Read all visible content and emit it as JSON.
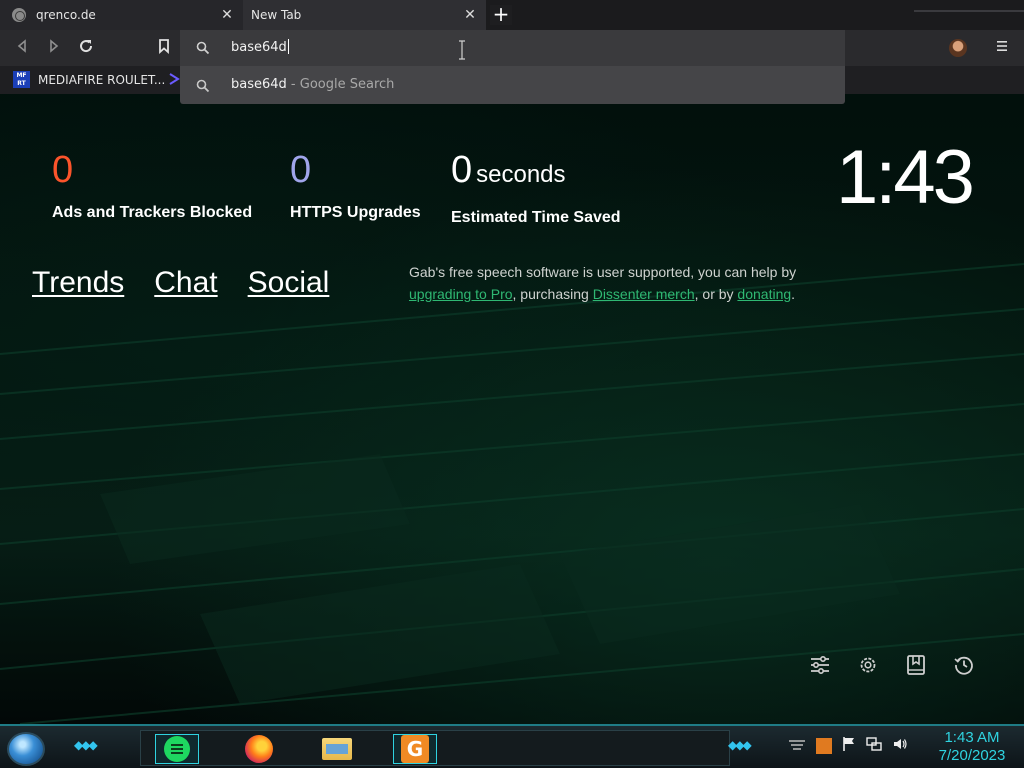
{
  "browser": {
    "tabs": [
      {
        "title": "qrenco.de",
        "close": "✕"
      },
      {
        "title": "New Tab",
        "close": "✕"
      }
    ],
    "new_tab": "+",
    "omnibox": {
      "text": "base64d"
    },
    "suggestion": {
      "query": "base64d",
      "suffix": " - Google Search"
    },
    "bookmarks": [
      {
        "icon_text": "MF RT",
        "label": "MEDIAFIRE ROULET..."
      }
    ],
    "icons": {
      "back": "back-arrow-icon",
      "forward": "forward-arrow-icon",
      "reload": "reload-icon",
      "bookmark": "bookmark-icon",
      "search": "search-icon",
      "menu": "hamburger-menu-icon"
    }
  },
  "stats": {
    "ads_blocked": {
      "value": "0",
      "label": "Ads and Trackers Blocked",
      "color": "#fb542b"
    },
    "https_upgrades": {
      "value": "0",
      "label": "HTTPS Upgrades",
      "color": "#a0a5eb"
    },
    "time_saved": {
      "value": "0",
      "unit": "seconds",
      "label": "Estimated Time Saved"
    }
  },
  "clock": "1:43",
  "top_links": [
    "Trends",
    "Chat",
    "Social"
  ],
  "gab": {
    "part1": "Gab's free speech software is user supported, you can help by ",
    "link1": "upgrading to Pro",
    "part2": ", purchasing ",
    "link2": "Dissenter merch",
    "part3": ", or by ",
    "link3": "donating",
    "part4": ".",
    "link_color": "#2fb873"
  },
  "bottom_icons": [
    "customize-sliders-icon",
    "settings-gear-icon",
    "bookmarks-icon",
    "history-icon"
  ],
  "taskbar": {
    "apps": [
      "chat-app",
      "firefox",
      "file-explorer",
      "g-app"
    ],
    "time": "1:43 AM",
    "date": "7/20/2023",
    "accent": "#2fd3e0"
  }
}
